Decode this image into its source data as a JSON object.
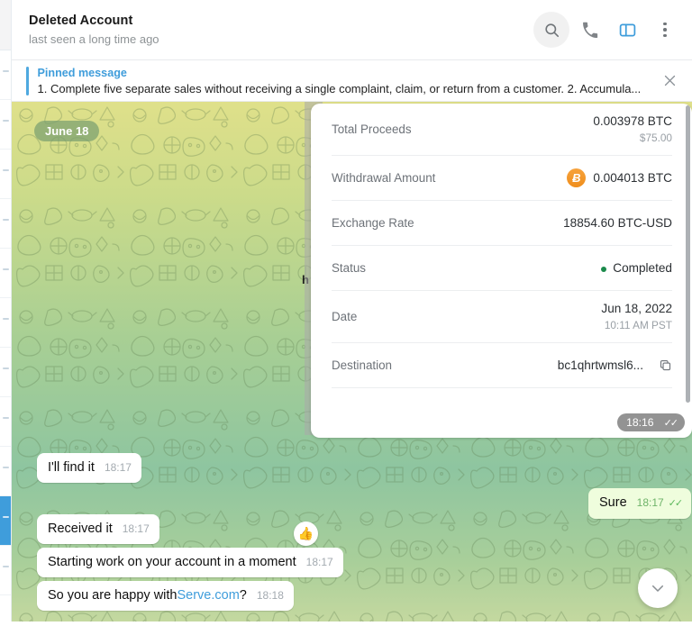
{
  "header": {
    "title": "Deleted Account",
    "subtitle": "last seen a long time ago",
    "icons": {
      "search": "search-icon",
      "call": "phone-icon",
      "sidebar": "sidebar-toggle-icon",
      "menu": "more-vertical-icon"
    }
  },
  "pinned": {
    "label": "Pinned message",
    "text": "1. Complete five separate sales without receiving a single complaint, claim, or return from a customer. 2. Accumula...",
    "close": "close-icon"
  },
  "date_badge": "June 18",
  "transaction_card": {
    "hidden_text_fragment": "h",
    "rows": [
      {
        "label": "Total Proceeds",
        "value": "0.003978 BTC",
        "sub": "$75.00",
        "icon": null,
        "status": false,
        "copy": false
      },
      {
        "label": "Withdrawal Amount",
        "value": "0.004013 BTC",
        "sub": null,
        "icon": "bitcoin-icon",
        "status": false,
        "copy": false
      },
      {
        "label": "Exchange Rate",
        "value": "18854.60 BTC-USD",
        "sub": null,
        "icon": null,
        "status": false,
        "copy": false
      },
      {
        "label": "Status",
        "value": "Completed",
        "sub": null,
        "icon": null,
        "status": true,
        "copy": false
      },
      {
        "label": "Date",
        "value": "Jun 18, 2022",
        "sub": "10:11 AM PST",
        "icon": null,
        "status": false,
        "copy": false
      },
      {
        "label": "Destination",
        "value": "bc1qhrtwmsl6...",
        "sub": null,
        "icon": null,
        "status": false,
        "copy": true
      }
    ],
    "time": "18:16",
    "ticks": "✓✓"
  },
  "reaction": "👍",
  "messages": [
    {
      "id": "b1",
      "text": "I'll find it",
      "time": "18:17",
      "out": false,
      "ticks": null
    },
    {
      "id": "b2",
      "text": "Sure",
      "time": "18:17",
      "out": true,
      "ticks": "✓✓"
    },
    {
      "id": "b3",
      "text": "Received it",
      "time": "18:17",
      "out": false,
      "ticks": null
    },
    {
      "id": "b4",
      "text": "Starting work on your account in a moment",
      "time": "18:17",
      "out": false,
      "ticks": null
    },
    {
      "id": "b5_pre",
      "text": "So you are happy with ",
      "link": "Serve.com",
      "post": "?",
      "time": "18:18",
      "out": false,
      "ticks": null
    }
  ],
  "scroll_button": "chevron-down-icon",
  "colors": {
    "accent_blue": "#3f9ddb",
    "out_bubble": "#effddd",
    "bitcoin_orange": "#ef8e1c",
    "status_green": "#1b8a4b",
    "date_badge_bg": "rgba(122,160,112,.72)"
  }
}
